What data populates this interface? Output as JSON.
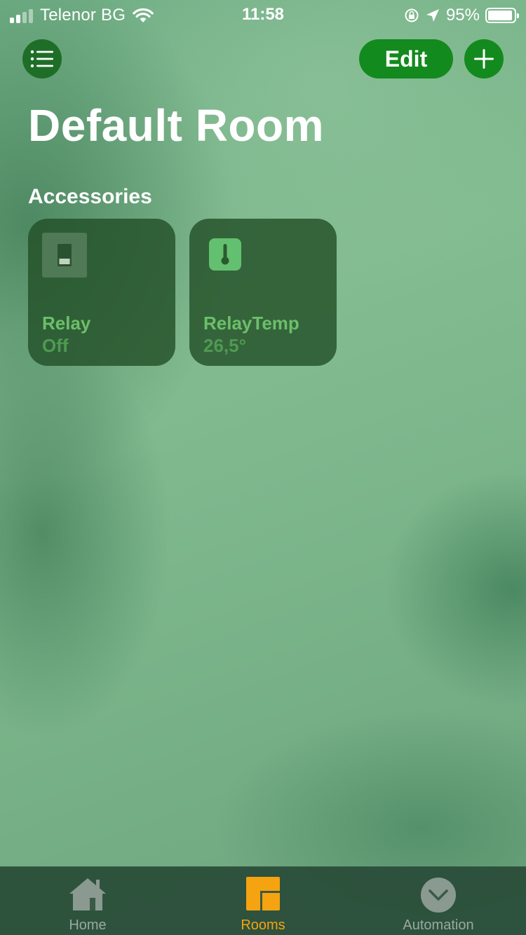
{
  "status_bar": {
    "carrier": "Telenor BG",
    "time": "11:58",
    "battery_percent": "95%",
    "battery_level": 0.95,
    "signal_bars_filled": 2,
    "icons": [
      "signal-icon",
      "wifi-icon",
      "orientation-lock-icon",
      "location-arrow-icon",
      "battery-icon"
    ]
  },
  "toolbar": {
    "list_icon": "list-icon",
    "edit_label": "Edit",
    "add_icon": "plus-icon"
  },
  "page": {
    "title": "Default Room",
    "section_title": "Accessories"
  },
  "accessories": [
    {
      "name": "Relay",
      "status": "Off",
      "icon": "switch-icon"
    },
    {
      "name": "RelayTemp",
      "status": "26,5°",
      "icon": "thermometer-icon"
    }
  ],
  "tab_bar": {
    "tabs": [
      {
        "label": "Home",
        "icon": "house-icon",
        "active": false
      },
      {
        "label": "Rooms",
        "icon": "rooms-icon",
        "active": true
      },
      {
        "label": "Automation",
        "icon": "clock-check-icon",
        "active": false
      }
    ]
  },
  "colors": {
    "accent_green": "#138a1e",
    "tab_active": "#f5a310",
    "tile_text": "#6cbf6a"
  }
}
